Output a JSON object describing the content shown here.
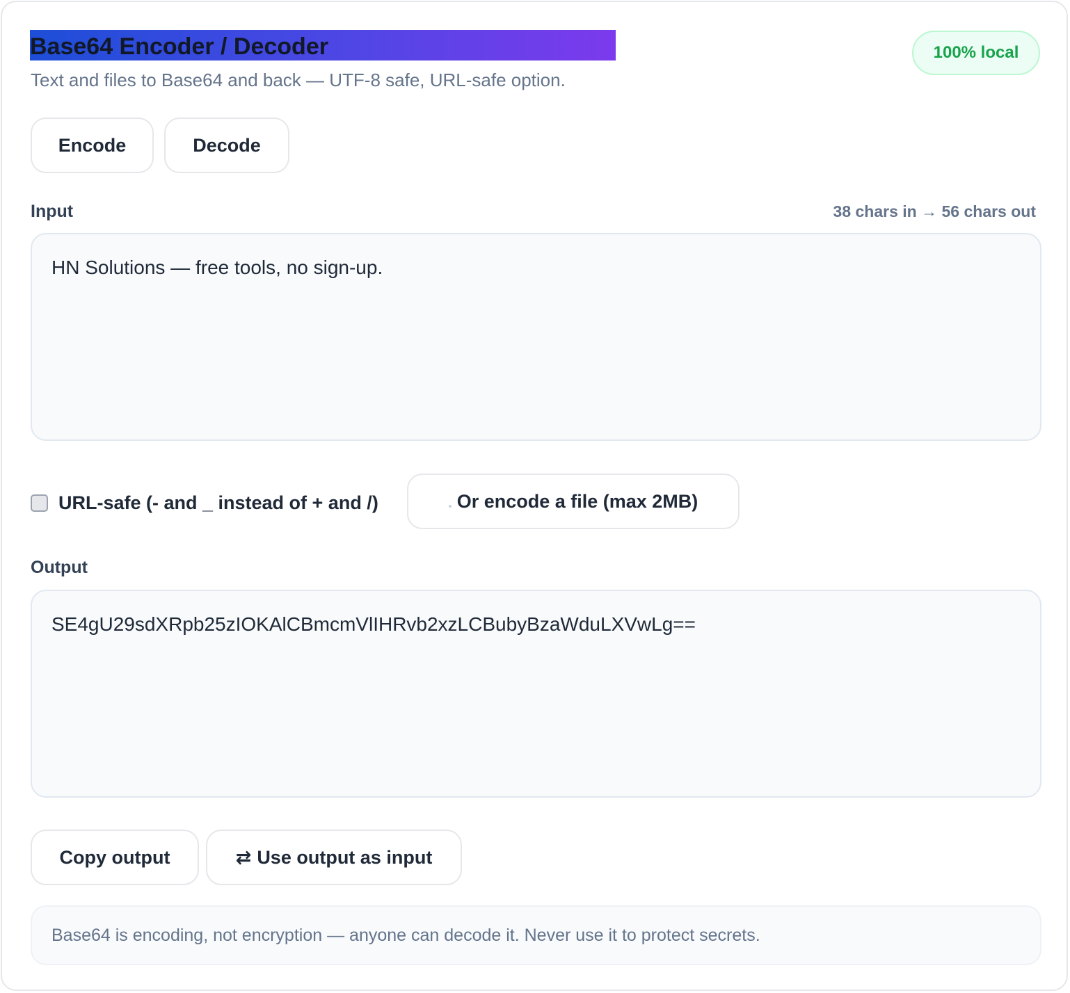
{
  "header": {
    "title": "Base64 Encoder / Decoder",
    "subtitle": "Text and files to Base64 and back — UTF-8 safe, URL-safe option.",
    "badge": "100% local"
  },
  "colors": {
    "title_gradient_start": "#1d4ed8",
    "title_gradient_end": "#7c3aed",
    "badge_text": "#16a34a",
    "badge_bg": "#ecfdf5"
  },
  "mode_buttons": {
    "encode": "Encode",
    "decode": "Decode"
  },
  "input": {
    "label": "Input",
    "counter": "38 chars in → 56 chars out",
    "value": "HN Solutions — free tools, no sign-up."
  },
  "options": {
    "url_safe_label": "URL-safe (- and _ instead of + and /)",
    "url_safe_checked": false,
    "file_button_label": "Or encode a file (max 2MB)"
  },
  "output": {
    "label": "Output",
    "value": "SE4gU29sdXRpb25zIOKAlCBmcmVlIHRvb2xzLCBubyBzaWduLXVwLg=="
  },
  "actions": {
    "copy_label": "Copy output",
    "swap_icon": "⇄",
    "swap_label": "Use output as input"
  },
  "note": "Base64 is encoding, not encryption — anyone can decode it. Never use it to protect secrets."
}
